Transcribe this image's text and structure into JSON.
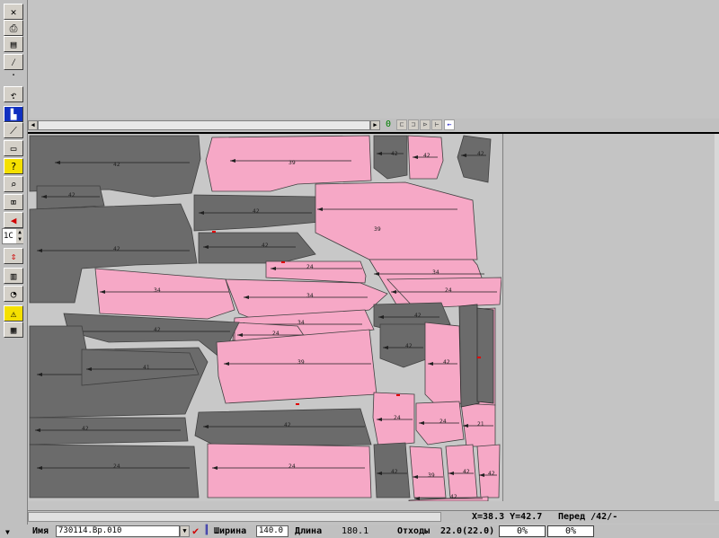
{
  "toolbar": {
    "buttons": [
      {
        "name": "close-layout-icon",
        "glyph": "✕"
      },
      {
        "name": "print-icon",
        "glyph": "⎙"
      },
      {
        "name": "plotter-icon",
        "glyph": "▤"
      },
      {
        "name": "magic-wand-icon",
        "glyph": "⁄"
      },
      {
        "name": "shrink-icon",
        "glyph": "·"
      },
      {
        "name": "undo-icon",
        "glyph": "↶"
      },
      {
        "name": "shrink-dots-icon",
        "glyph": "·"
      },
      {
        "name": "layout-mode-icon",
        "glyph": "▙"
      },
      {
        "name": "ruler-icon",
        "glyph": "⟋"
      },
      {
        "name": "frame-icon",
        "glyph": "▭"
      },
      {
        "name": "help-icon",
        "glyph": "?"
      },
      {
        "name": "zoom-icon",
        "glyph": "⌕"
      },
      {
        "name": "disabled-icon",
        "glyph": "⌧"
      },
      {
        "name": "move-left-icon",
        "glyph": "◀"
      },
      {
        "name": "flip-icon",
        "glyph": "⇕"
      },
      {
        "name": "trash-icon",
        "glyph": "▥"
      },
      {
        "name": "tape-icon",
        "glyph": "◔"
      },
      {
        "name": "warning-icon",
        "glyph": "⚠"
      },
      {
        "name": "report-icon",
        "glyph": "▦"
      }
    ],
    "zoom_value": "1C"
  },
  "top_strip": {
    "scroll_value": "0"
  },
  "status": {
    "coords": "X=38.3 Y=42.7",
    "piece_info": "Перед /42/-",
    "name_label": "Имя",
    "name_value": "730114.Вр.010",
    "width_label": "Ширина",
    "width_value": "140.0",
    "length_label": "Длина",
    "length_value": "180.1",
    "waste_label": "Отходы",
    "waste_value": "22.0(22.0)",
    "pct_1": "0%",
    "pct_2": "0%"
  },
  "colors": {
    "pink": "#f6a8c6",
    "gray": "#6b6b6b",
    "marker_bg": "#c8c8c8"
  },
  "pieces": [
    {
      "label": "42"
    },
    {
      "label": "39"
    },
    {
      "label": "42"
    },
    {
      "label": "42"
    },
    {
      "label": "42"
    },
    {
      "label": "42"
    },
    {
      "label": "42"
    },
    {
      "label": "39"
    },
    {
      "label": "42"
    },
    {
      "label": "42"
    },
    {
      "label": "24"
    },
    {
      "label": "34"
    },
    {
      "label": "34"
    },
    {
      "label": "34"
    },
    {
      "label": "24"
    },
    {
      "label": "34"
    },
    {
      "label": "42"
    },
    {
      "label": "24"
    },
    {
      "label": "42"
    },
    {
      "label": "41"
    },
    {
      "label": "41"
    },
    {
      "label": "39"
    },
    {
      "label": "42"
    },
    {
      "label": "42"
    },
    {
      "label": "39"
    },
    {
      "label": "42"
    },
    {
      "label": "42"
    },
    {
      "label": "24"
    },
    {
      "label": "24"
    },
    {
      "label": "21"
    },
    {
      "label": "24"
    },
    {
      "label": "24"
    }
  ]
}
